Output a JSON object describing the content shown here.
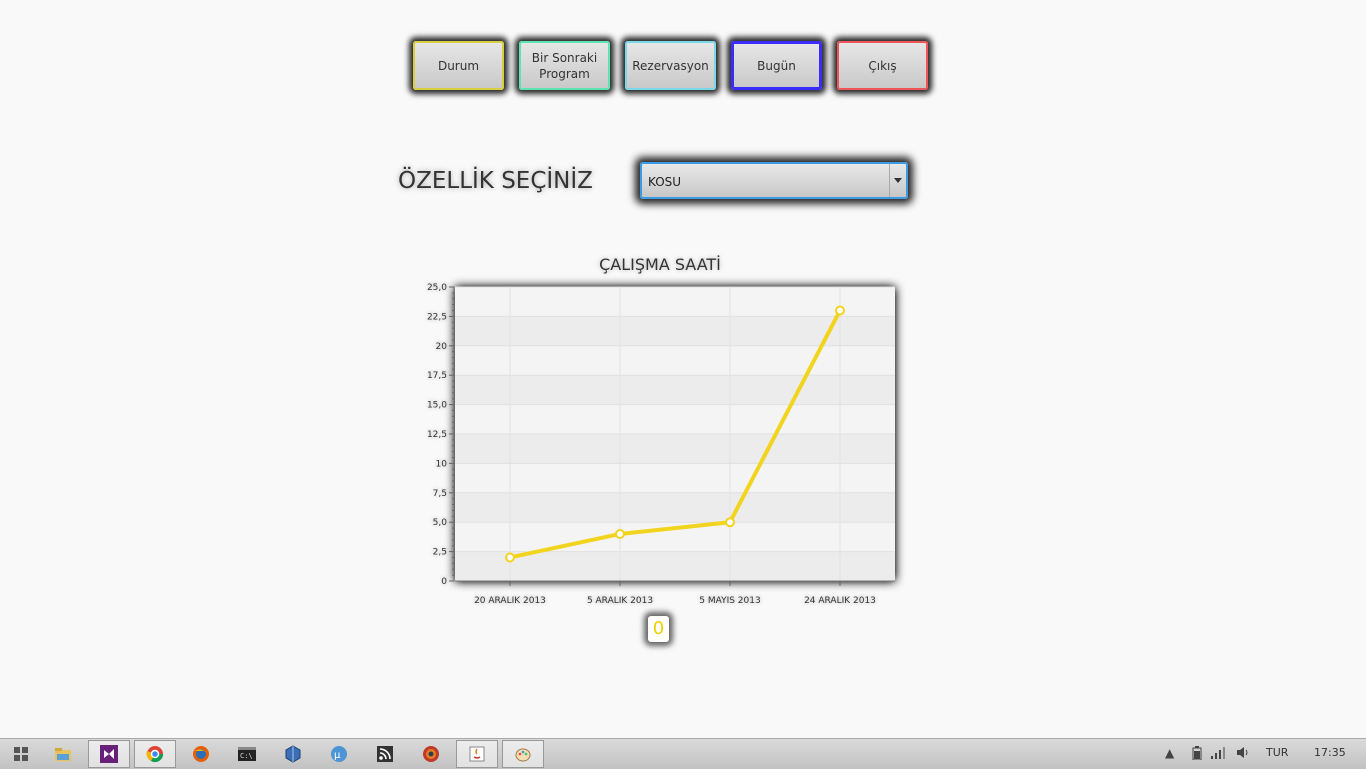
{
  "buttons": {
    "durum": "Durum",
    "bir_sonraki_line1": "Bir Sonraki",
    "bir_sonraki_line2": "Program",
    "rezervasyon": "Rezervasyon",
    "bugun": "Bugün",
    "cikis": "Çıkış"
  },
  "feature": {
    "label": "ÖZELLİK SEÇİNİZ",
    "selected": "KOSU"
  },
  "zero_label": "0",
  "chart_data": {
    "type": "line",
    "title": "ÇALIŞMA SAATİ",
    "categories": [
      "20 ARALIK 2013",
      "5 ARALIK 2013",
      "5 MAYIS 2013",
      "24 ARALIK 2013"
    ],
    "series": [
      {
        "values": [
          2,
          4,
          5,
          23
        ],
        "color": "#f2d41f"
      }
    ],
    "ylim": [
      0,
      25
    ],
    "yticks": [
      "0",
      "2,5",
      "5,0",
      "7,5",
      "10",
      "12,5",
      "15,0",
      "17,5",
      "20",
      "22,5",
      "25,0"
    ],
    "grid": true
  },
  "taskbar": {
    "icons": [
      "windows-start-icon",
      "file-explorer-icon",
      "visual-studio-icon",
      "chrome-icon",
      "firefox-icon",
      "command-prompt-icon",
      "virtualbox-icon",
      "utorrent-icon",
      "rss-icon",
      "browser-icon",
      "java-icon",
      "paint-icon"
    ],
    "language": "TUR",
    "time": "17:35"
  }
}
